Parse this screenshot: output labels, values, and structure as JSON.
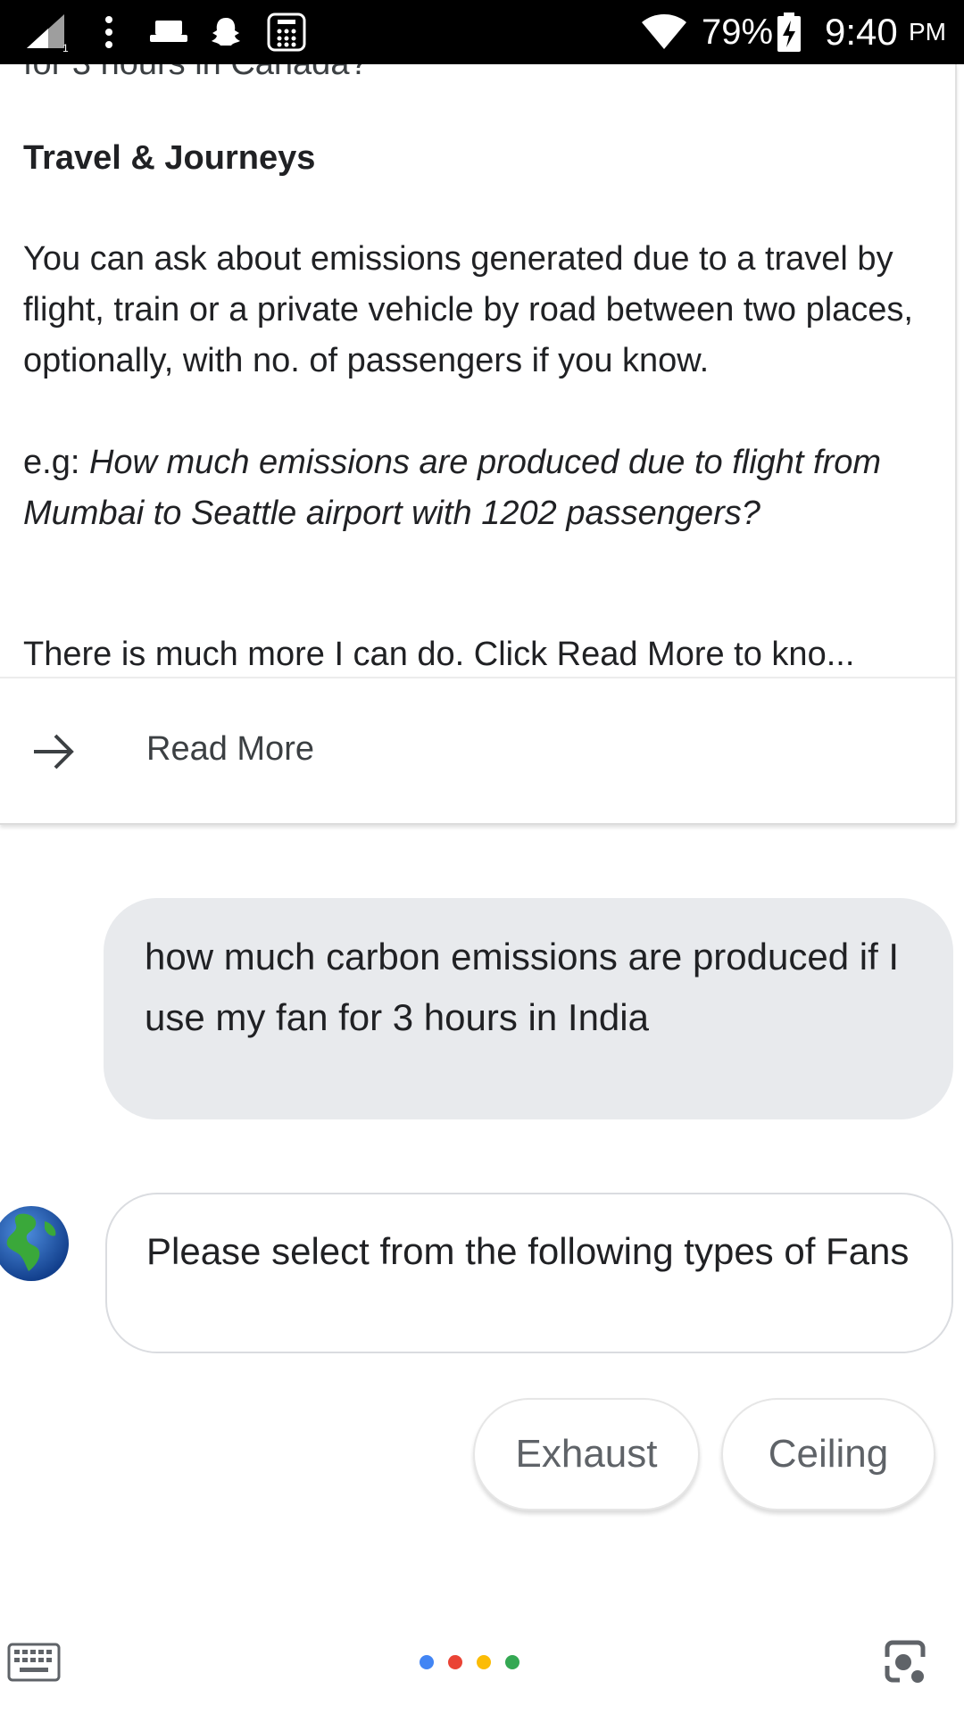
{
  "status_bar": {
    "battery_percent": "79%",
    "time": "9:40",
    "ampm": "PM",
    "icons": [
      "signal-icon",
      "more-vert-icon",
      "screen-cast-icon",
      "snapchat-icon",
      "calculator-icon",
      "wifi-icon",
      "battery-charging-icon"
    ]
  },
  "card": {
    "cut_text": "for 3 hours in Canada?",
    "section_title": "Travel & Journeys",
    "description": "You can ask about emissions generated due to a travel by flight, train or a private vehicle by road between two places, optionally, with no. of passengers if you know.",
    "example_prefix": "e.g: ",
    "example_query": "How much emissions are produced due to flight from Mumbai to Seattle airport with 1202 passengers?",
    "more_text": "There is much more I can do. Click Read More to kno...",
    "read_more_label": "Read More",
    "read_more_icon": "arrow-right-icon"
  },
  "user_message": {
    "text": "how much carbon emissions are produced if I use my fan for 3 hours in India"
  },
  "bot_message": {
    "avatar_icon": "globe-icon",
    "text": "Please select from the following types of Fans"
  },
  "suggestions": [
    {
      "label": "Exhaust"
    },
    {
      "label": "Ceiling"
    }
  ],
  "bottom_bar": {
    "keyboard_icon": "keyboard-icon",
    "lens_icon": "lens-icon",
    "dot_colors": [
      "#4285F4",
      "#EA4335",
      "#FBBC05",
      "#34A853"
    ]
  },
  "colors": {
    "user_bubble": "#e8eaed",
    "bot_bubble_border": "#dadce0",
    "chip_text": "#5f6368"
  }
}
